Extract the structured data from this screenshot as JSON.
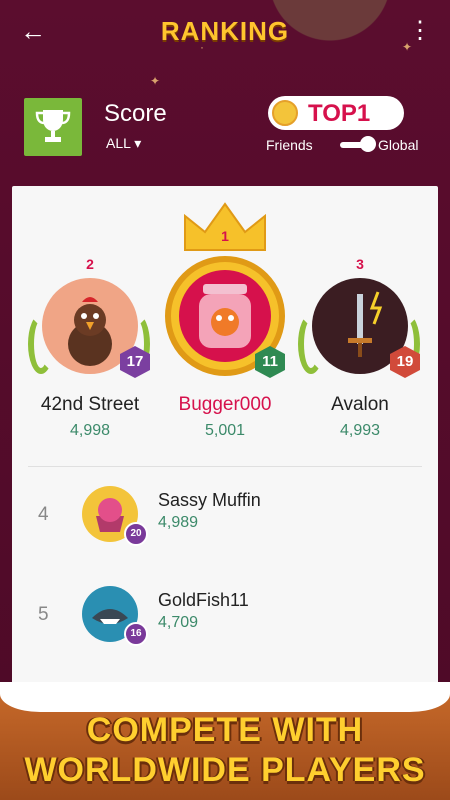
{
  "header": {
    "title": "RANKING"
  },
  "score": {
    "label": "Score",
    "filter": "ALL ▾",
    "badge": "TOP1",
    "toggle_left": "Friends",
    "toggle_right": "Global"
  },
  "podium": [
    {
      "rank": "2",
      "name": "42nd Street",
      "score": "4,998",
      "level": "17",
      "level_color": "#7b3fa0"
    },
    {
      "rank": "1",
      "name": "Bugger000",
      "score": "5,001",
      "level": "11",
      "level_color": "#2f8a52"
    },
    {
      "rank": "3",
      "name": "Avalon",
      "score": "4,993",
      "level": "19",
      "level_color": "#d14a3a"
    }
  ],
  "list": [
    {
      "rank": "4",
      "name": "Sassy Muffin",
      "score": "4,989",
      "level": "20"
    },
    {
      "rank": "5",
      "name": "GoldFish11",
      "score": "4,709",
      "level": "16"
    }
  ],
  "banner": {
    "line1": "COMPETE WITH",
    "line2": "WORLDWIDE PLAYERS"
  },
  "colors": {
    "accent": "#d6114c",
    "gold": "#ffc52e",
    "background": "#5a0d2b",
    "score_green": "#3c8a6a"
  }
}
